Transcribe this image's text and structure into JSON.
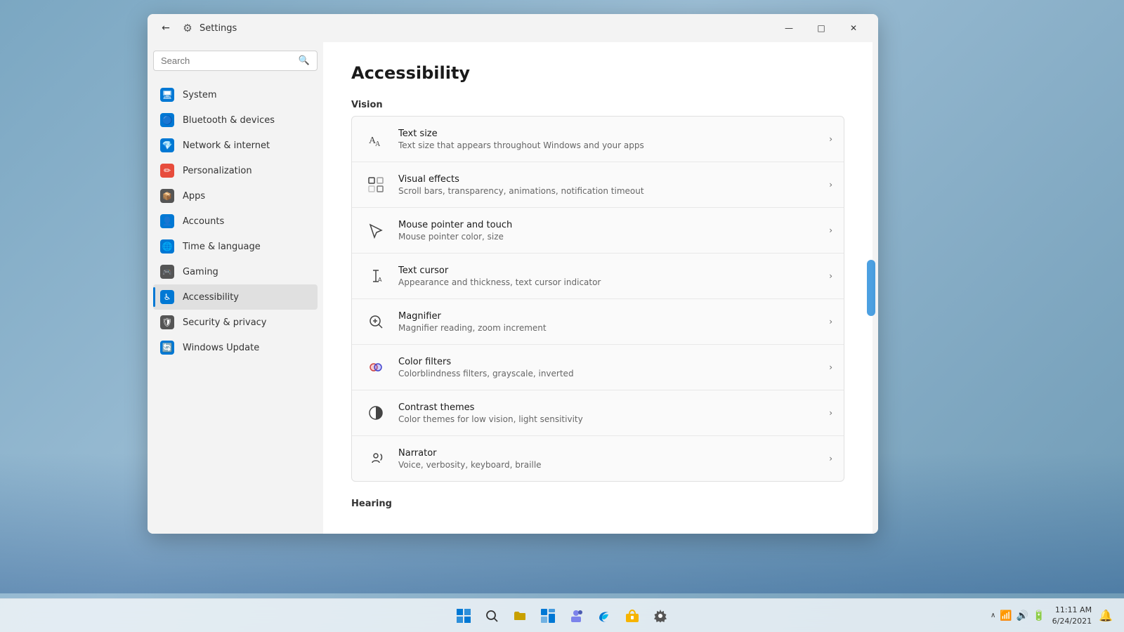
{
  "window": {
    "title": "Settings",
    "back_label": "←",
    "minimize": "—",
    "maximize": "□",
    "close": "✕"
  },
  "sidebar": {
    "search_placeholder": "Search",
    "nav_items": [
      {
        "id": "system",
        "label": "System",
        "icon": "🖥",
        "active": false
      },
      {
        "id": "bluetooth",
        "label": "Bluetooth & devices",
        "icon": "🔵",
        "active": false
      },
      {
        "id": "network",
        "label": "Network & internet",
        "icon": "💎",
        "active": false
      },
      {
        "id": "personalization",
        "label": "Personalization",
        "icon": "✏",
        "active": false
      },
      {
        "id": "apps",
        "label": "Apps",
        "icon": "📦",
        "active": false
      },
      {
        "id": "accounts",
        "label": "Accounts",
        "icon": "👤",
        "active": false
      },
      {
        "id": "time",
        "label": "Time & language",
        "icon": "🌐",
        "active": false
      },
      {
        "id": "gaming",
        "label": "Gaming",
        "icon": "🎮",
        "active": false
      },
      {
        "id": "accessibility",
        "label": "Accessibility",
        "icon": "♿",
        "active": true
      },
      {
        "id": "security",
        "label": "Security & privacy",
        "icon": "🛡",
        "active": false
      },
      {
        "id": "update",
        "label": "Windows Update",
        "icon": "🔄",
        "active": false
      }
    ]
  },
  "main": {
    "page_title": "Accessibility",
    "sections": [
      {
        "id": "vision",
        "label": "Vision",
        "items": [
          {
            "id": "text-size",
            "title": "Text size",
            "description": "Text size that appears throughout Windows and your apps",
            "icon": "🔤"
          },
          {
            "id": "visual-effects",
            "title": "Visual effects",
            "description": "Scroll bars, transparency, animations, notification timeout",
            "icon": "✨"
          },
          {
            "id": "mouse-pointer",
            "title": "Mouse pointer and touch",
            "description": "Mouse pointer color, size",
            "icon": "🖱"
          },
          {
            "id": "text-cursor",
            "title": "Text cursor",
            "description": "Appearance and thickness, text cursor indicator",
            "icon": "📝"
          },
          {
            "id": "magnifier",
            "title": "Magnifier",
            "description": "Magnifier reading, zoom increment",
            "icon": "🔍"
          },
          {
            "id": "color-filters",
            "title": "Color filters",
            "description": "Colorblindness filters, grayscale, inverted",
            "icon": "🎨"
          },
          {
            "id": "contrast-themes",
            "title": "Contrast themes",
            "description": "Color themes for low vision, light sensitivity",
            "icon": "◑"
          },
          {
            "id": "narrator",
            "title": "Narrator",
            "description": "Voice, verbosity, keyboard, braille",
            "icon": "📢"
          }
        ]
      },
      {
        "id": "hearing",
        "label": "Hearing",
        "items": []
      }
    ]
  },
  "taskbar": {
    "time": "11:11 AM",
    "date": "6/24/2021",
    "icons": [
      "⊞",
      "🔍",
      "📁",
      "⬛",
      "💬",
      "📂",
      "🌐",
      "🛍",
      "⚙"
    ]
  }
}
